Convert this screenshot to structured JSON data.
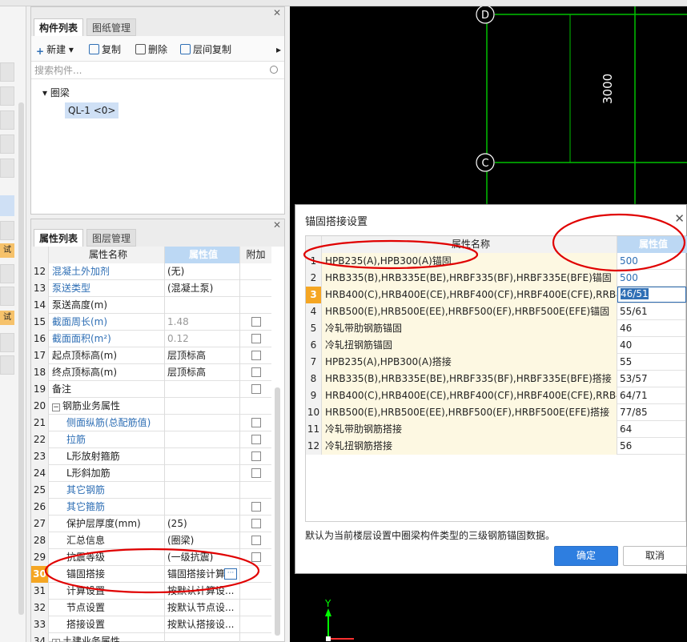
{
  "component_panel": {
    "tab_active": "构件列表",
    "tab_inactive": "图纸管理",
    "toolbar": {
      "new_label": "新建",
      "copy_label": "复制",
      "delete_label": "删除",
      "floor_copy_label": "层间复制"
    },
    "search_placeholder": "搜索构件...",
    "tree_root": "圈梁",
    "tree_leaf": "QL-1 <0>"
  },
  "left_tags": [
    "试用",
    "试用"
  ],
  "property_panel": {
    "tab_active": "属性列表",
    "tab_inactive": "图层管理",
    "headers": {
      "name": "属性名称",
      "value": "属性值",
      "add": "附加"
    },
    "rows": [
      {
        "num": "12",
        "name": "混凝土外加剂",
        "value": "(无)",
        "blue": true,
        "cb": false
      },
      {
        "num": "13",
        "name": "泵送类型",
        "value": "(混凝土泵)",
        "blue": true,
        "cb": false
      },
      {
        "num": "14",
        "name": "泵送高度(m)",
        "value": "",
        "blue": false,
        "cb": false
      },
      {
        "num": "15",
        "name": "截面周长(m)",
        "value": "1.48",
        "blue": true,
        "cb": true,
        "grayval": true
      },
      {
        "num": "16",
        "name": "截面面积(m²)",
        "value": "0.12",
        "blue": true,
        "cb": true,
        "grayval": true
      },
      {
        "num": "17",
        "name": "起点顶标高(m)",
        "value": "层顶标高",
        "blue": false,
        "cb": true
      },
      {
        "num": "18",
        "name": "终点顶标高(m)",
        "value": "层顶标高",
        "blue": false,
        "cb": true
      },
      {
        "num": "19",
        "name": "备注",
        "value": "",
        "blue": false,
        "cb": true
      },
      {
        "num": "20",
        "name": "钢筋业务属性",
        "value": "",
        "blue": false,
        "cb": false,
        "group": true
      },
      {
        "num": "21",
        "name": "侧面纵筋(总配筋值)",
        "value": "",
        "blue": true,
        "cb": true,
        "child": true
      },
      {
        "num": "22",
        "name": "拉筋",
        "value": "",
        "blue": true,
        "cb": true,
        "child": true
      },
      {
        "num": "23",
        "name": "L形放射箍筋",
        "value": "",
        "blue": false,
        "cb": true,
        "child": true
      },
      {
        "num": "24",
        "name": "L形斜加筋",
        "value": "",
        "blue": false,
        "cb": true,
        "child": true
      },
      {
        "num": "25",
        "name": "其它钢筋",
        "value": "",
        "blue": true,
        "cb": false,
        "child": true
      },
      {
        "num": "26",
        "name": "其它箍筋",
        "value": "",
        "blue": true,
        "cb": true,
        "child": true
      },
      {
        "num": "27",
        "name": "保护层厚度(mm)",
        "value": "(25)",
        "blue": false,
        "cb": true,
        "child": true
      },
      {
        "num": "28",
        "name": "汇总信息",
        "value": "(圈梁)",
        "blue": false,
        "cb": true,
        "child": true
      },
      {
        "num": "29",
        "name": "抗震等级",
        "value": "(一级抗震)",
        "blue": false,
        "cb": true,
        "child": true
      },
      {
        "num": "30",
        "name": "锚固搭接",
        "value": "锚固搭接计算",
        "blue": false,
        "cb": false,
        "child": true,
        "selected": true
      },
      {
        "num": "31",
        "name": "计算设置",
        "value": "按默认计算设...",
        "blue": false,
        "cb": false,
        "child": true
      },
      {
        "num": "32",
        "name": "节点设置",
        "value": "按默认节点设...",
        "blue": false,
        "cb": false,
        "child": true
      },
      {
        "num": "33",
        "name": "搭接设置",
        "value": "按默认搭接设...",
        "blue": false,
        "cb": false,
        "child": true
      },
      {
        "num": "34",
        "name": "土建业务属性",
        "value": "",
        "blue": false,
        "cb": false,
        "group": true,
        "collapsed": true
      }
    ]
  },
  "cad": {
    "axis_d": "D",
    "axis_c": "C",
    "dimension": "3000",
    "axis_y": "Y"
  },
  "dialog": {
    "title": "锚固搭接设置",
    "headers": {
      "name": "属性名称",
      "value": "属性值"
    },
    "rows": [
      {
        "num": "1",
        "name": "HPB235(A),HPB300(A)锚固",
        "value": "500",
        "blue": true
      },
      {
        "num": "2",
        "name": "HRB335(B),HRB335E(BE),HRBF335(BF),HRBF335E(BFE)锚固",
        "value": "500",
        "blue": true
      },
      {
        "num": "3",
        "name": "HRB400(C),HRB400E(CE),HRBF400(CF),HRBF400E(CFE),RRB40...",
        "value": "46/51",
        "editing": true
      },
      {
        "num": "4",
        "name": "HRB500(E),HRB500E(EE),HRBF500(EF),HRBF500E(EFE)锚固",
        "value": "55/61"
      },
      {
        "num": "5",
        "name": "冷轧带肋钢筋锚固",
        "value": "46"
      },
      {
        "num": "6",
        "name": "冷轧扭钢筋锚固",
        "value": "40"
      },
      {
        "num": "7",
        "name": "HPB235(A),HPB300(A)搭接",
        "value": "55"
      },
      {
        "num": "8",
        "name": "HRB335(B),HRB335E(BE),HRBF335(BF),HRBF335E(BFE)搭接",
        "value": "53/57"
      },
      {
        "num": "9",
        "name": "HRB400(C),HRB400E(CE),HRBF400(CF),HRBF400E(CFE),RRB40...",
        "value": "64/71"
      },
      {
        "num": "10",
        "name": "HRB500(E),HRB500E(EE),HRBF500(EF),HRBF500E(EFE)搭接",
        "value": "77/85"
      },
      {
        "num": "11",
        "name": "冷轧带肋钢筋搭接",
        "value": "64"
      },
      {
        "num": "12",
        "name": "冷轧扭钢筋搭接",
        "value": "56"
      }
    ],
    "note": "默认为当前楼层设置中圈梁构件类型的三级钢筋锚固数据。",
    "ok_label": "确定",
    "cancel_label": "取消"
  },
  "colors": {
    "accent": "#2e7ee0",
    "selected_row": "#f5a623",
    "annotation": "#e00000",
    "cad_grid": "#00c000"
  }
}
